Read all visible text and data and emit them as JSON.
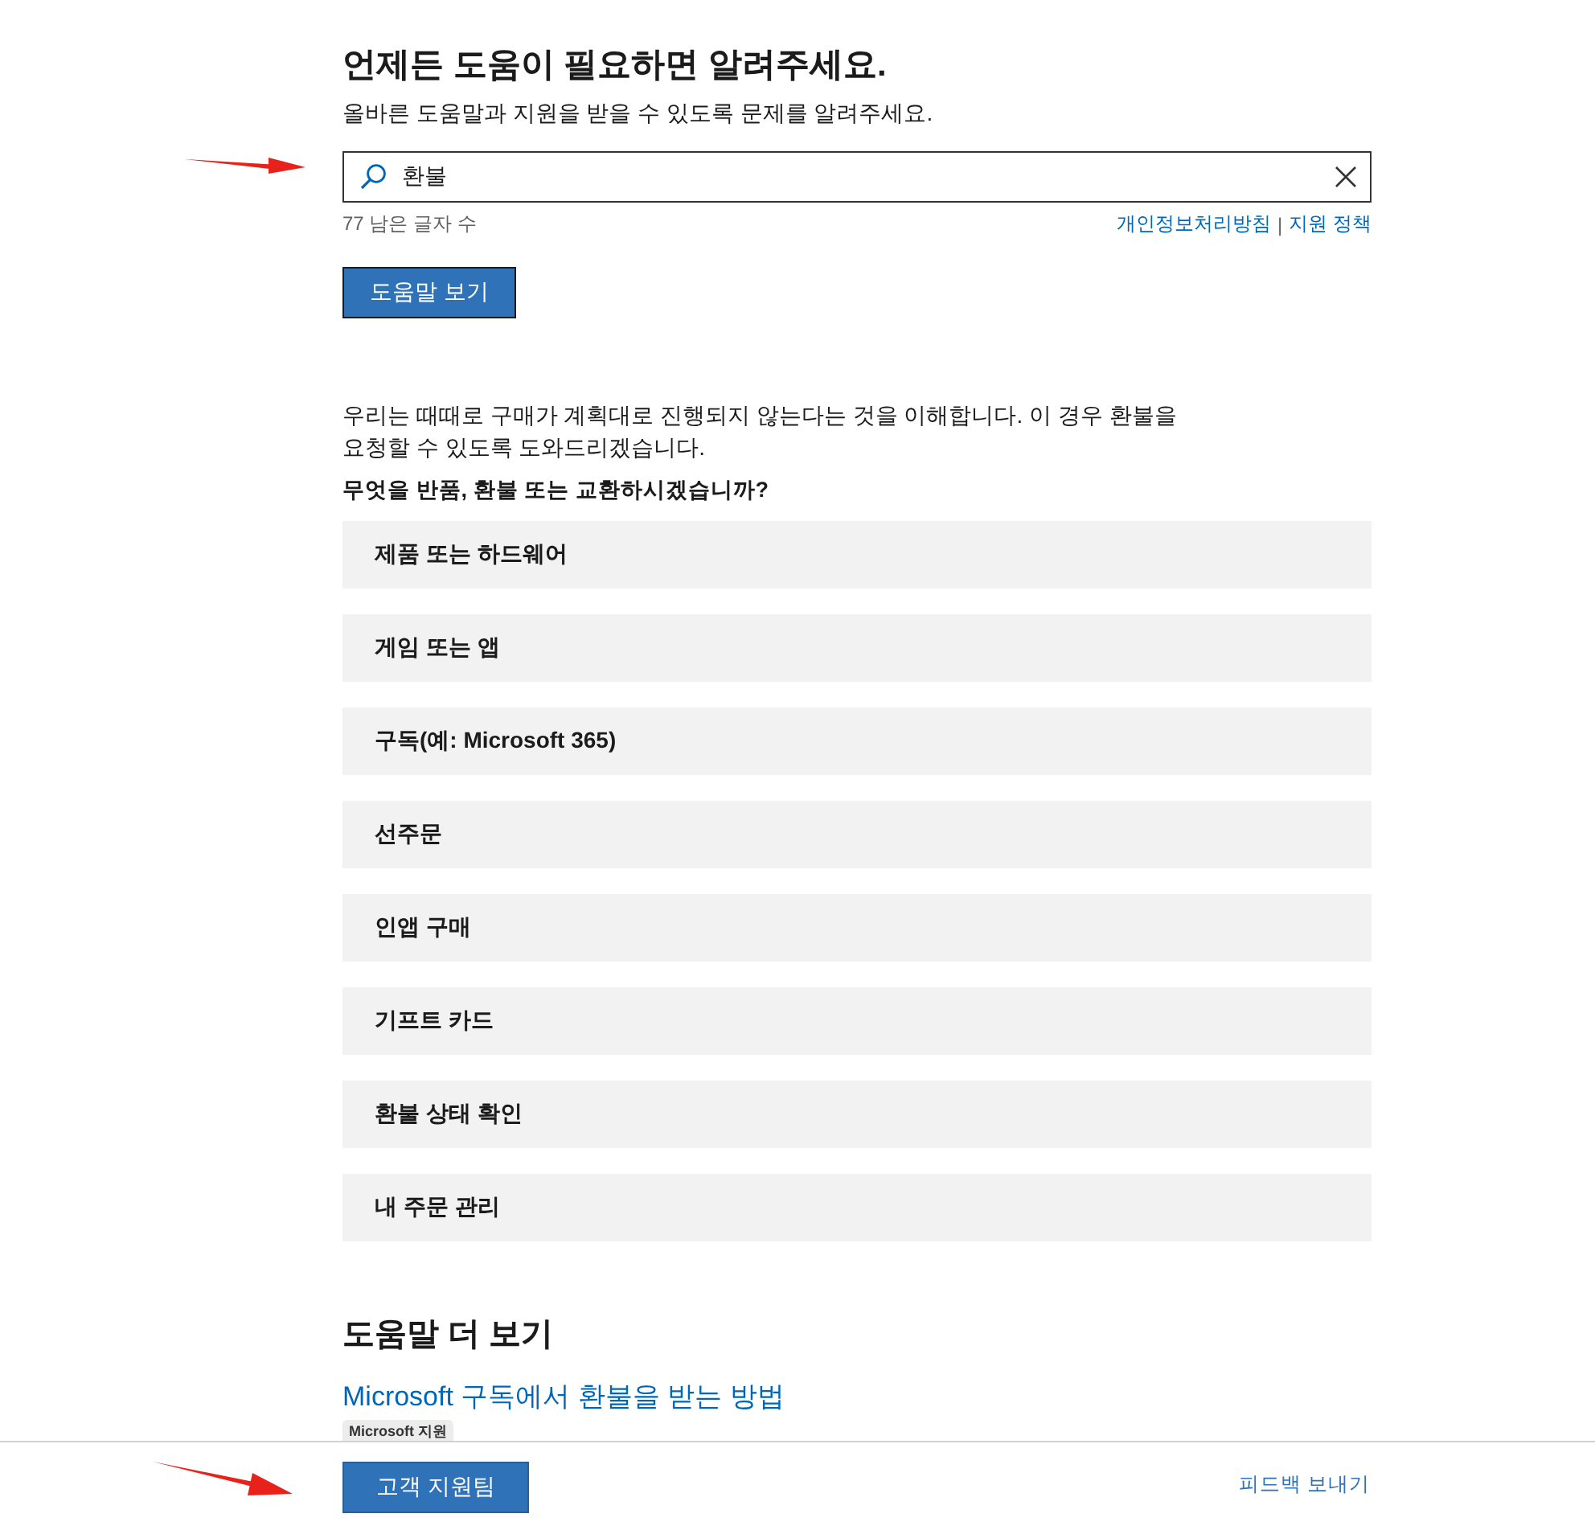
{
  "heading": "언제든 도움이 필요하면 알려주세요.",
  "subheading": "올바른 도움말과 지원을 받을 수 있도록 문제를 알려주세요.",
  "search": {
    "value": "환불"
  },
  "char_count": "77 남은 글자 수",
  "links": [
    {
      "label": "개인정보처리방침"
    },
    {
      "label": "지원 정책"
    }
  ],
  "separator": "|",
  "help_button": "도움말 보기",
  "intro": "우리는 때때로 구매가 계획대로 진행되지 않는다는 것을 이해합니다. 이 경우 환불을 요청할 수 있도록 도와드리겠습니다.",
  "question": "무엇을 반품, 환불 또는 교환하시겠습니까?",
  "options": [
    {
      "label": "제품 또는 하드웨어"
    },
    {
      "label": "게임 또는 앱"
    },
    {
      "label": "구독(예: Microsoft 365)"
    },
    {
      "label": "선주문"
    },
    {
      "label": "인앱 구매"
    },
    {
      "label": "기프트 카드"
    },
    {
      "label": "환불 상태 확인"
    },
    {
      "label": "내 주문 관리"
    }
  ],
  "more_help": {
    "title": "도움말 더 보기",
    "articles": [
      {
        "title": "Microsoft 구독에서 환불을 받는 방법",
        "tag": "Microsoft 지원"
      }
    ]
  },
  "footer": {
    "contact_button": "고객 지원팀",
    "feedback_link": "피드백 보내기"
  }
}
